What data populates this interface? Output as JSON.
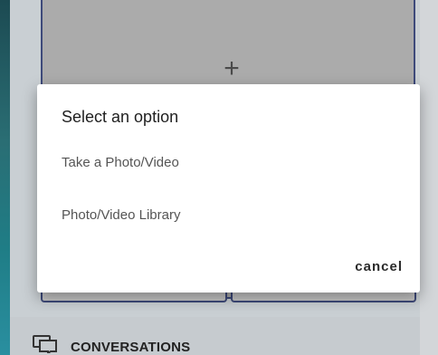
{
  "background": {
    "upload_card": {
      "plus_label": "+"
    },
    "conversations": {
      "icon": "chat-bubbles-icon",
      "label": "CONVERSATIONS"
    }
  },
  "dialog": {
    "title": "Select an option",
    "options": [
      {
        "label": "Take a Photo/Video"
      },
      {
        "label": "Photo/Video Library"
      }
    ],
    "cancel_label": "cancel"
  },
  "colors": {
    "accent_teal": "#2a8fa0",
    "card_border": "#3e4a7a",
    "dialog_bg": "#ffffff"
  }
}
